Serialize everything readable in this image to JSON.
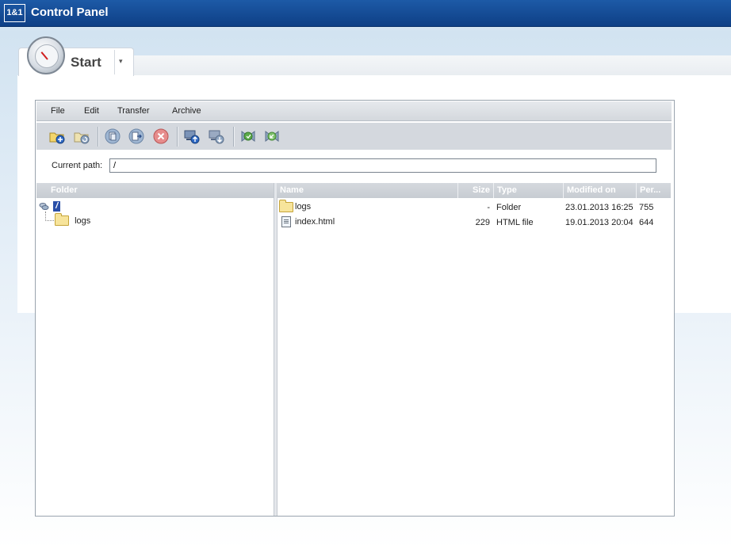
{
  "header": {
    "logo": "1&1",
    "title": "Control Panel"
  },
  "tab": {
    "label": "Start",
    "dropdown": "▾"
  },
  "menu": [
    "File",
    "Edit",
    "Transfer",
    "Archive"
  ],
  "toolbar": {
    "icons": [
      "new-folder-icon",
      "refresh-folder-icon",
      "copy-icon",
      "move-icon",
      "delete-icon",
      "upload-icon",
      "download-icon",
      "extract-icon",
      "compress-icon"
    ]
  },
  "path": {
    "label": "Current path:",
    "value": "/"
  },
  "tree": {
    "header": "Folder",
    "root": "/",
    "items": [
      "logs"
    ]
  },
  "files": {
    "columns": {
      "name": "Name",
      "size": "Size",
      "type": "Type",
      "modified": "Modified on",
      "perm": "Per..."
    },
    "rows": [
      {
        "name": "logs",
        "size": "-",
        "type": "Folder",
        "modified": "23.01.2013 16:25",
        "perm": "755",
        "icon": "folder-icon"
      },
      {
        "name": "index.html",
        "size": "229",
        "type": "HTML file",
        "modified": "19.01.2013 20:04",
        "perm": "644",
        "icon": "html-file-icon"
      }
    ]
  },
  "colors": {
    "header_blue": "#1d5aa7",
    "panel_gray": "#d4d8de"
  }
}
